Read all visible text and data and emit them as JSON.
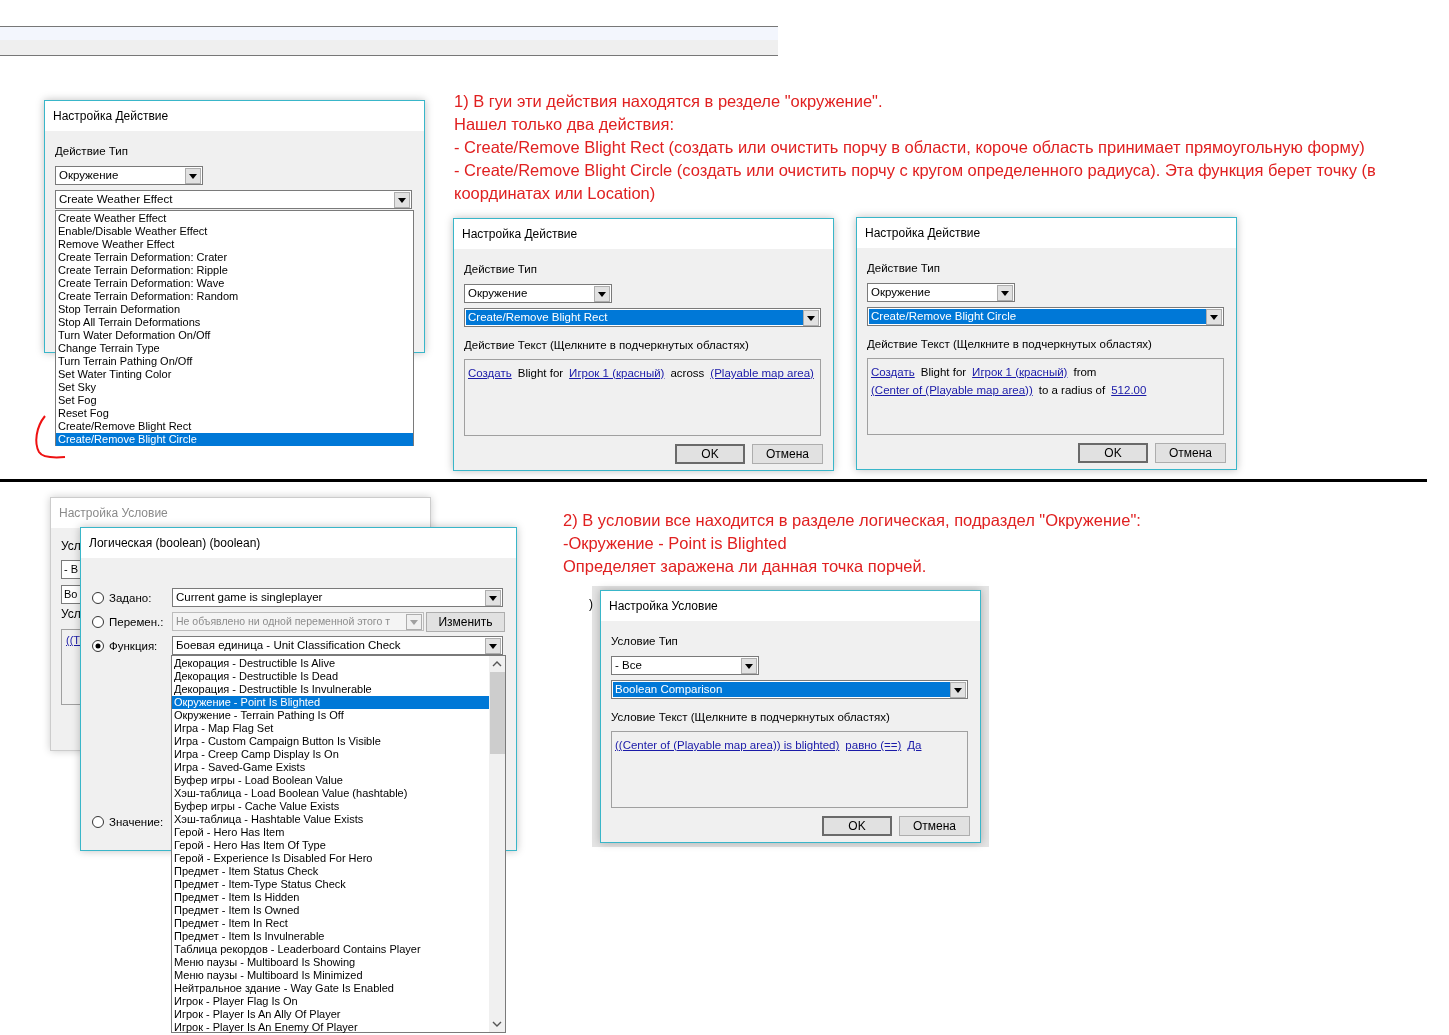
{
  "action_list_dialog": {
    "title": "Настройка Действие",
    "type_label": "Действие Тип",
    "category": "Окружение",
    "action": "Create Weather Effect",
    "options": [
      {
        "label": "Create Weather Effect",
        "selected": false
      },
      {
        "label": "Enable/Disable Weather Effect",
        "selected": false
      },
      {
        "label": "Remove Weather Effect",
        "selected": false
      },
      {
        "label": "Create Terrain Deformation: Crater",
        "selected": false
      },
      {
        "label": "Create Terrain Deformation: Ripple",
        "selected": false
      },
      {
        "label": "Create Terrain Deformation: Wave",
        "selected": false
      },
      {
        "label": "Create Terrain Deformation: Random",
        "selected": false
      },
      {
        "label": "Stop Terrain Deformation",
        "selected": false
      },
      {
        "label": "Stop All Terrain Deformations",
        "selected": false
      },
      {
        "label": "Turn Water Deformation On/Off",
        "selected": false
      },
      {
        "label": "Change Terrain Type",
        "selected": false
      },
      {
        "label": "Turn Terrain Pathing On/Off",
        "selected": false
      },
      {
        "label": "Set Water Tinting Color",
        "selected": false
      },
      {
        "label": "Set Sky",
        "selected": false
      },
      {
        "label": "Set Fog",
        "selected": false
      },
      {
        "label": "Reset Fog",
        "selected": false
      },
      {
        "label": "Create/Remove Blight Rect",
        "selected": false
      },
      {
        "label": "Create/Remove Blight Circle",
        "selected": true
      }
    ]
  },
  "note_1": {
    "lines": [
      "1) В гуи эти действия находятся в резделе \"окружение\".",
      "Нашел только два действия:",
      "- Create/Remove Blight Rect (создать или очистить порчу в области, короче область принимает прямоугольную форму)",
      "- Create/Remove Blight Circle (создать или очистить порчу с кругом определенного радиуса). Эта функция берет точку (в",
      "координатах или Location)"
    ]
  },
  "action_dialogs": [
    {
      "title": "Настройка Действие",
      "type_label": "Действие Тип",
      "category": "Окружение",
      "action": "Create/Remove Blight Rect",
      "text_label": "Действие Текст (Щелкните в подчеркнутых областях)",
      "text_lines": [
        [
          {
            "text": "Создать",
            "link": true
          },
          {
            "text": "Blight for",
            "link": false
          },
          {
            "text": "Игрок 1 (красный)",
            "link": true
          },
          {
            "text": "across",
            "link": false
          },
          {
            "text": "(Playable map area)",
            "link": true
          }
        ]
      ],
      "buttons": [
        "OK",
        "Отмена"
      ]
    },
    {
      "title": "Настройка Действие",
      "type_label": "Действие Тип",
      "category": "Окружение",
      "action": "Create/Remove Blight Circle",
      "text_label": "Действие Текст (Щелкните в подчеркнутых областях)",
      "text_lines": [
        [
          {
            "text": "Создать",
            "link": true
          },
          {
            "text": "Blight for",
            "link": false
          },
          {
            "text": "Игрок 1 (красный)",
            "link": true
          },
          {
            "text": "from",
            "link": false
          }
        ],
        [
          {
            "text": "(Center of (Playable map area))",
            "link": true
          },
          {
            "text": "to a radius of",
            "link": false
          },
          {
            "text": "512.00",
            "link": true
          }
        ]
      ],
      "buttons": [
        "OK",
        "Отмена"
      ]
    }
  ],
  "condition_bg_dialog": {
    "title": "Настройка Условие",
    "fragments": [
      {
        "kind": "label",
        "text": "Усл"
      },
      {
        "kind": "combo",
        "text": "- B"
      },
      {
        "kind": "combo",
        "text": "Bo"
      },
      {
        "kind": "label",
        "text": "Усл"
      },
      {
        "kind": "link",
        "text": "((T"
      }
    ]
  },
  "boolean_dialog": {
    "title": "Логическая (boolean) (boolean)",
    "rows": [
      {
        "label": "Задано:",
        "checked": false,
        "kind": "combo",
        "value": "Current game is singleplayer",
        "disabled": false
      },
      {
        "label": "Перемен.:",
        "checked": false,
        "kind": "combo_button",
        "value": "Не объявлено ни одной переменной этого т",
        "disabled": true,
        "button": "Изменить"
      },
      {
        "label": "Функция:",
        "checked": true,
        "kind": "combo",
        "value": "Боевая единица - Unit Classification Check",
        "disabled": false
      },
      {
        "label": "Значение:",
        "checked": false,
        "kind": "none"
      }
    ],
    "function_list": [
      {
        "label": "Декорация - Destructible Is Alive",
        "selected": false
      },
      {
        "label": "Декорация - Destructible Is Dead",
        "selected": false
      },
      {
        "label": "Декорация - Destructible Is Invulnerable",
        "selected": false
      },
      {
        "label": "Окружение - Point Is Blighted",
        "selected": true
      },
      {
        "label": "Окружение - Terrain Pathing Is Off",
        "selected": false
      },
      {
        "label": "Игра - Map Flag Set",
        "selected": false
      },
      {
        "label": "Игра - Custom Campaign Button Is Visible",
        "selected": false
      },
      {
        "label": "Игра - Creep Camp Display Is On",
        "selected": false
      },
      {
        "label": "Игра - Saved-Game Exists",
        "selected": false
      },
      {
        "label": "Буфер игры - Load Boolean Value",
        "selected": false
      },
      {
        "label": "Хэш-таблица - Load Boolean Value (hashtable)",
        "selected": false
      },
      {
        "label": "Буфер игры - Cache Value Exists",
        "selected": false
      },
      {
        "label": "Хэш-таблица - Hashtable Value Exists",
        "selected": false
      },
      {
        "label": "Герой - Hero Has Item",
        "selected": false
      },
      {
        "label": "Герой - Hero Has Item Of Type",
        "selected": false
      },
      {
        "label": "Герой - Experience Is Disabled For Hero",
        "selected": false
      },
      {
        "label": "Предмет - Item Status Check",
        "selected": false
      },
      {
        "label": "Предмет - Item-Type Status Check",
        "selected": false
      },
      {
        "label": "Предмет - Item Is Hidden",
        "selected": false
      },
      {
        "label": "Предмет - Item Is Owned",
        "selected": false
      },
      {
        "label": "Предмет - Item In Rect",
        "selected": false
      },
      {
        "label": "Предмет - Item Is Invulnerable",
        "selected": false
      },
      {
        "label": "Таблица рекордов - Leaderboard Contains Player",
        "selected": false
      },
      {
        "label": "Меню паузы - Multiboard Is Showing",
        "selected": false
      },
      {
        "label": "Меню паузы - Multiboard Is Minimized",
        "selected": false
      },
      {
        "label": "Нейтральное здание - Way Gate Is Enabled",
        "selected": false
      },
      {
        "label": "Игрок - Player Flag Is On",
        "selected": false
      },
      {
        "label": "Игрок - Player Is An Ally Of Player",
        "selected": false
      },
      {
        "label": "Игрок - Player Is An Enemy Of Player",
        "selected": false
      }
    ]
  },
  "note_2": {
    "lines": [
      "2) В условии все находится в разделе логическая, подраздел \"Окружение\":",
      "-Окружение - Point is Blighted",
      "Определяет заражена ли данная точка порчей."
    ]
  },
  "condition_dialog": {
    "fragment": ")",
    "title": "Настройка Условие",
    "type_label": "Условие Тип",
    "category": "- Все",
    "condition": "Boolean Comparison",
    "text_label": "Условие Текст (Щелкните в подчеркнутых областях)",
    "text_lines": [
      [
        {
          "text": "((Center of (Playable map area)) is blighted)",
          "link": true
        },
        {
          "text": "равно (==)",
          "link": true
        },
        {
          "text": "Да",
          "link": true
        }
      ]
    ],
    "buttons": [
      "OK",
      "Отмена"
    ]
  }
}
